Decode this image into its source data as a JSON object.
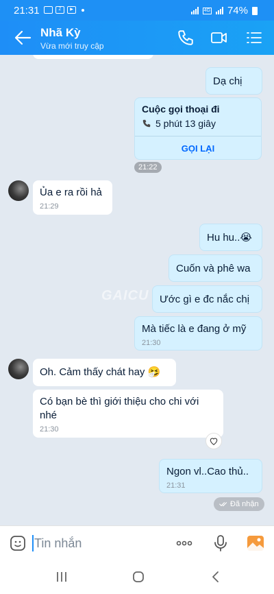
{
  "status": {
    "time": "21:31",
    "battery": "74%",
    "network": "4G"
  },
  "header": {
    "name": "Nhã Kỳ",
    "subtitle": "Vừa mới truy cập"
  },
  "messages": {
    "m1": "Dạ chị",
    "call": {
      "title": "Cuộc gọi thoại đi",
      "duration": "5 phút 13 giây",
      "action": "GỌI LẠI",
      "time": "21:22"
    },
    "m2": {
      "text": "Ủa e ra rồi hả",
      "time": "21:29"
    },
    "m3": "Hu hu..😭",
    "m4": "Cuốn và phê wa",
    "m5": "Ước gì e đc nắc chị",
    "m6": {
      "text": "Mà tiếc là e đang ở mỹ",
      "time": "21:30"
    },
    "m7": "Oh. Cảm thấy chát hay 🤧",
    "m8": {
      "text": "Có bạn bè thì giới thiệu cho chi với nhé",
      "time": "21:30"
    },
    "m9": {
      "text": "Ngon vl..Cao thủ..",
      "time": "21:31"
    },
    "received": "Đã nhận"
  },
  "watermark": "GAICU",
  "input": {
    "placeholder": "Tin nhắn"
  },
  "colors": {
    "header": "#1e8ef7",
    "my_bubble": "#d5f1ff",
    "chat_bg": "#e2e9f1",
    "link": "#0068ff"
  }
}
